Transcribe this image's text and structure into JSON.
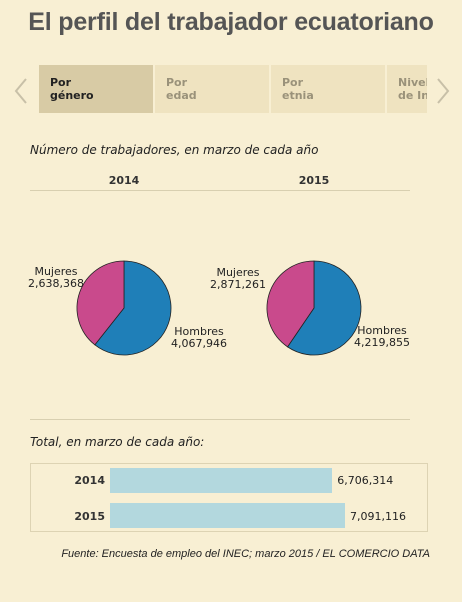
{
  "page": {
    "title": "El perfil del trabajador ecuatoriano",
    "source": "Fuente: Encuesta de empleo del INEC; marzo 2015 / EL COMERCIO DATA"
  },
  "tabs": [
    {
      "line1": "Por",
      "line2": "género",
      "active": true
    },
    {
      "line1": "Por",
      "line2": "edad",
      "active": false
    },
    {
      "line1": "Por",
      "line2": "etnia",
      "active": false
    },
    {
      "line1": "Nivel",
      "line2": "de Instrucción",
      "active": false
    }
  ],
  "pies_section": {
    "label": "Número de trabajadores, en marzo de cada año"
  },
  "totals_section": {
    "label": "Total, en marzo de cada año:"
  },
  "colors": {
    "mujeres": "#c94a8c",
    "hombres": "#1f7fb8",
    "bar": "#b3d8de"
  },
  "chart_data": [
    {
      "type": "pie",
      "title": "2014",
      "categories": [
        "Mujeres",
        "Hombres"
      ],
      "values": [
        2638368,
        4067946
      ],
      "labels": [
        "2,638,368",
        "4,067,946"
      ]
    },
    {
      "type": "pie",
      "title": "2015",
      "categories": [
        "Mujeres",
        "Hombres"
      ],
      "values": [
        2871261,
        4219855
      ],
      "labels": [
        "2,871,261",
        "4,219,855"
      ]
    },
    {
      "type": "bar",
      "orientation": "horizontal",
      "categories": [
        "2014",
        "2015"
      ],
      "values": [
        6706314,
        7091116
      ],
      "labels": [
        "6,706,314",
        "7,091,116"
      ]
    }
  ]
}
